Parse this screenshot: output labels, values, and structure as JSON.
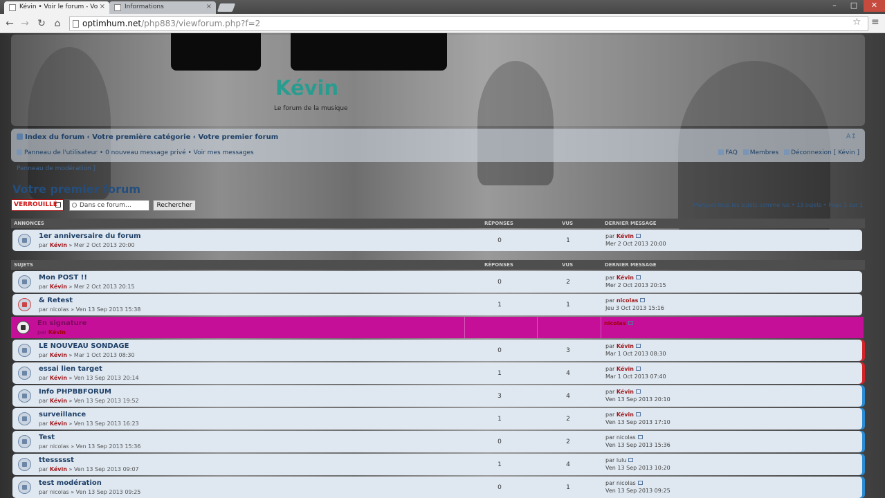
{
  "browser": {
    "tabs": [
      {
        "title": "Kévin • Voir le forum - Vo"
      },
      {
        "title": "Informations"
      }
    ],
    "url_host": "optimhum.net",
    "url_path": "/php883/viewforum.php?f=2"
  },
  "header": {
    "site_title": "Kévin",
    "site_desc": "Le forum de la musique"
  },
  "navbar": {
    "breadcrumb": "Index du forum ‹ Votre première catégorie ‹ Votre premier forum",
    "userlinks": [
      "Panneau de l'utilisateur",
      "0 nouveau message privé",
      "Voir mes messages"
    ],
    "userlinks_sep": " • ",
    "faq": "FAQ",
    "members": "Membres",
    "logout": "Déconnexion [ Kévin ]"
  },
  "modlink": "Panneau de modération ]",
  "forum_title": "Votre premier forum",
  "actions": {
    "locked_label": "VERROUILLÉ",
    "search_placeholder": "Dans ce forum…",
    "search_button": "Rechercher"
  },
  "pagination": "Marquer tous les sujets comme lus • 13 sujets • Page 1 sur 1",
  "announcements_header": {
    "section": "ANNONCES",
    "replies": "RÉPONSES",
    "views": "VUS",
    "last": "DERNIER MESSAGE"
  },
  "topics_header": {
    "section": "SUJETS",
    "replies": "RÉPONSES",
    "views": "VUS",
    "last": "DERNIER MESSAGE"
  },
  "announcements": [
    {
      "title": "1er anniversaire du forum",
      "by": "par ",
      "author": "Kévin",
      "date": " » Mer 2 Oct 2013 20:00",
      "replies": "0",
      "views": "1",
      "last_by": "par ",
      "last_author": "Kévin",
      "last_date": "Mer 2 Oct 2013 20:00"
    }
  ],
  "topics": [
    {
      "title": "Mon POST !!",
      "by": "par ",
      "author": "Kévin",
      "date": " » Mer 2 Oct 2013 20:15",
      "replies": "0",
      "views": "2",
      "last_by": "par ",
      "last_author": "Kévin",
      "last_date": "Mer 2 Oct 2013 20:15"
    },
    {
      "title": "& Retest",
      "by": "par nicolas",
      "author": "",
      "date": " » Ven 13 Sep 2013 15:38",
      "replies": "1",
      "views": "1",
      "last_by": "par ",
      "last_author": "nicolas",
      "last_date": "Jeu 3 Oct 2013 15:16"
    },
    {
      "title": "En signature",
      "by": "par ",
      "author": "Kévin",
      "date": "",
      "replies": "",
      "views": "",
      "last_by": "",
      "last_author": "nicolas",
      "last_date": ""
    },
    {
      "title": "LE NOUVEAU SONDAGE",
      "by": "par ",
      "author": "Kévin",
      "date": " » Mar 1 Oct 2013 08:30",
      "replies": "0",
      "views": "3",
      "last_by": "par ",
      "last_author": "Kévin",
      "last_date": "Mar 1 Oct 2013 08:30"
    },
    {
      "title": "essai lien target",
      "by": "par ",
      "author": "Kévin",
      "date": " » Ven 13 Sep 2013 20:14",
      "replies": "1",
      "views": "4",
      "last_by": "par ",
      "last_author": "Kévin",
      "last_date": "Mar 1 Oct 2013 07:40"
    },
    {
      "title": "Info PHPBBFORUM",
      "by": "par ",
      "author": "Kévin",
      "date": " » Ven 13 Sep 2013 19:52",
      "replies": "3",
      "views": "4",
      "last_by": "par ",
      "last_author": "Kévin",
      "last_date": "Ven 13 Sep 2013 20:10"
    },
    {
      "title": "surveillance",
      "by": "par ",
      "author": "Kévin",
      "date": " » Ven 13 Sep 2013 16:23",
      "replies": "1",
      "views": "2",
      "last_by": "par ",
      "last_author": "Kévin",
      "last_date": "Ven 13 Sep 2013 17:10"
    },
    {
      "title": "Test",
      "by": "par nicolas",
      "author": "",
      "date": " » Ven 13 Sep 2013 15:36",
      "replies": "0",
      "views": "2",
      "last_by": "par nicolas",
      "last_author": "",
      "last_date": "Ven 13 Sep 2013 15:36"
    },
    {
      "title": "ttessssst",
      "by": "par ",
      "author": "Kévin",
      "date": " » Ven 13 Sep 2013 09:07",
      "replies": "1",
      "views": "4",
      "last_by": "par lulu",
      "last_author": "",
      "last_date": "Ven 13 Sep 2013 10:20"
    },
    {
      "title": "test modération",
      "by": "par nicolas",
      "author": "",
      "date": " » Ven 13 Sep 2013 09:25",
      "replies": "0",
      "views": "1",
      "last_by": "par nicolas",
      "last_author": "",
      "last_date": "Ven 13 Sep 2013 09:25"
    }
  ],
  "colors": {
    "highlight_row": "#c60f98",
    "author_red": "#a0161a",
    "row_bg": "#dfe8f1",
    "edge_red": "#d2232a",
    "edge_blue": "#2a8ad2",
    "title_teal": "#2a9c8f"
  }
}
